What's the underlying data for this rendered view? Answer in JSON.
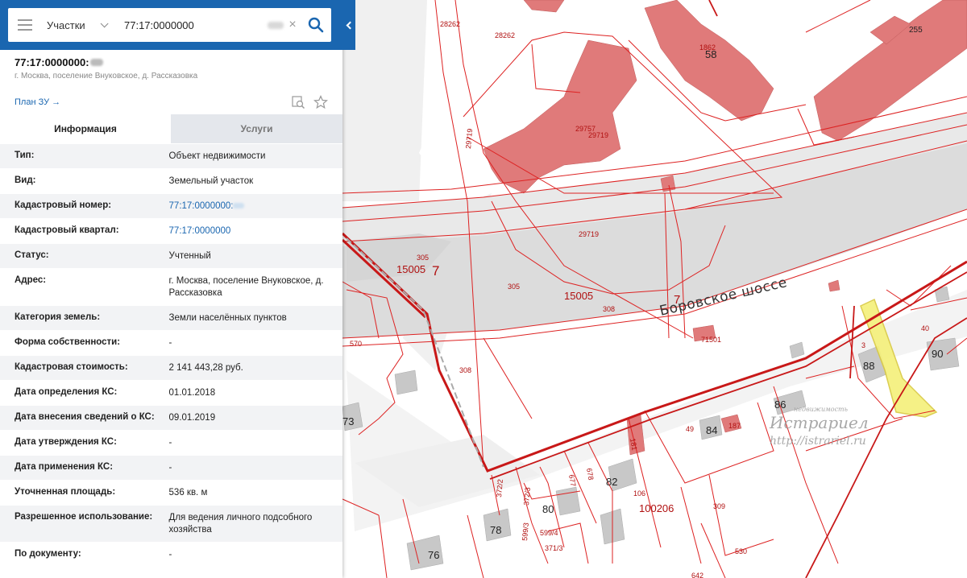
{
  "search": {
    "layer": "Участки",
    "query": "77:17:0000000"
  },
  "object": {
    "title": "77:17:0000000:",
    "address": "г. Москва, поселение Внуковское, д. Рассказовка",
    "plan_link": "План ЗУ →"
  },
  "tabs": [
    {
      "label": "Информация",
      "active": true
    },
    {
      "label": "Услуги",
      "active": false
    }
  ],
  "properties": [
    {
      "key": "Тип:",
      "value": "Объект недвижимости"
    },
    {
      "key": "Вид:",
      "value": "Земельный участок"
    },
    {
      "key": "Кадастровый номер:",
      "value": "77:17:0000000:",
      "link": true
    },
    {
      "key": "Кадастровый квартал:",
      "value": "77:17:0000000",
      "link": true
    },
    {
      "key": "Статус:",
      "value": "Учтенный"
    },
    {
      "key": "Адрес:",
      "value": "г. Москва, поселение Внуковское, д. Рассказовка"
    },
    {
      "key": "Категория земель:",
      "value": "Земли населённых пунктов"
    },
    {
      "key": "Форма собственности:",
      "value": "-"
    },
    {
      "key": "Кадастровая стоимость:",
      "value": "2 141 443,28 руб."
    },
    {
      "key": "Дата определения КС:",
      "value": "01.01.2018"
    },
    {
      "key": "Дата внесения сведений о КС:",
      "value": "09.01.2019"
    },
    {
      "key": "Дата утверждения КС:",
      "value": "-"
    },
    {
      "key": "Дата применения КС:",
      "value": "-"
    },
    {
      "key": "Уточненная площадь:",
      "value": "536 кв. м"
    },
    {
      "key": "Разрешенное использование:",
      "value": "Для ведения личного подсобного хозяйства"
    },
    {
      "key": "По документу:",
      "value": "-"
    }
  ],
  "map": {
    "road_name": "Боровское шоссе",
    "parcel_labels": [
      "28262",
      "28262",
      "29719",
      "29757",
      "29719",
      "29719",
      "305",
      "15005",
      "7",
      "305",
      "15005",
      "308",
      "7",
      "71501",
      "308",
      "570",
      "40",
      "3",
      "187",
      "49",
      "181",
      "678",
      "677",
      "372/2",
      "372/3",
      "599/3",
      "599/4",
      "371/3",
      "106",
      "100206",
      "309",
      "530",
      "642"
    ],
    "house_numbers": [
      "58",
      "1862",
      "255",
      "88",
      "90",
      "86",
      "84",
      "82",
      "80",
      "78",
      "76",
      "73"
    ],
    "watermark_brand": "Истрариел",
    "watermark_url": "http://istrariel.ru",
    "watermark_small": "недвижимость",
    "colors": {
      "building": "#e07a7a",
      "parcel_line": "#c81818",
      "road": "#dcdcdc",
      "highlight": "#f5f07a",
      "panel_header": "#1a66b0"
    }
  }
}
